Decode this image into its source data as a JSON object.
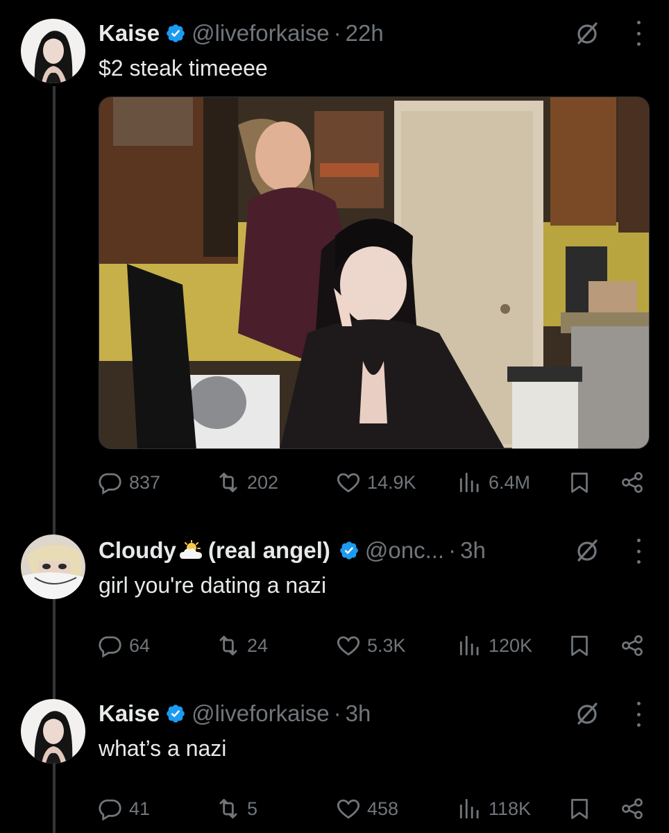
{
  "tweets": [
    {
      "name": "Kaise",
      "handle": "@liveforkaise",
      "time": "22h",
      "text": "$2 steak timeeee",
      "replies": "837",
      "reposts": "202",
      "likes": "14.9K",
      "views": "6.4M"
    },
    {
      "name": "Cloudy",
      "name_suffix": "(real angel)",
      "handle": "@onc...",
      "time": "3h",
      "text": "girl you're dating a nazi",
      "replies": "64",
      "reposts": "24",
      "likes": "5.3K",
      "views": "120K"
    },
    {
      "name": "Kaise",
      "handle": "@liveforkaise",
      "time": "3h",
      "text": "what’s a nazi",
      "replies": "41",
      "reposts": "5",
      "likes": "458",
      "views": "118K"
    }
  ],
  "separator": "·",
  "colors": {
    "background": "#000000",
    "text_primary": "#e7e9ea",
    "text_secondary": "#71767b",
    "verified": "#1d9bf0"
  },
  "icons": [
    "verified-badge-icon",
    "grok-icon",
    "more-icon",
    "reply-icon",
    "repost-icon",
    "like-icon",
    "views-icon",
    "bookmark-icon",
    "share-icon",
    "cloud-sun-emoji"
  ]
}
